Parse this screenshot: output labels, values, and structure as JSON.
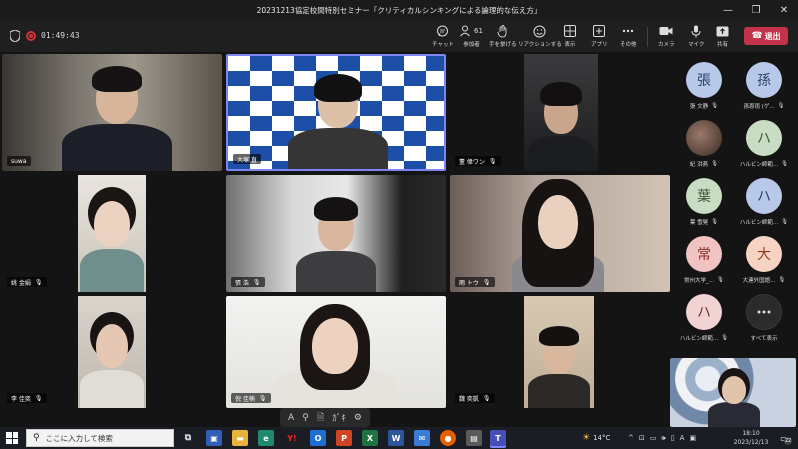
{
  "window": {
    "title": "20231213協定校間特別セミナー「クリティカルシンキングによる論理的な伝え方」",
    "controls": [
      "—",
      "❐",
      "✕"
    ]
  },
  "meeting": {
    "timer": "01:49:43",
    "participants_count": "61",
    "toolbar": [
      {
        "id": "chat",
        "icon": "chat-icon",
        "label": "チャット"
      },
      {
        "id": "people",
        "icon": "people-icon",
        "label": "参加者"
      },
      {
        "id": "raise",
        "icon": "hand-icon",
        "label": "手を挙げる"
      },
      {
        "id": "react",
        "icon": "smile-icon",
        "label": "リアクションする"
      },
      {
        "id": "view",
        "icon": "grid-icon",
        "label": "表示"
      },
      {
        "id": "apps",
        "icon": "plus-square-icon",
        "label": "アプリ"
      },
      {
        "id": "more",
        "icon": "ellipsis-icon",
        "label": "その他"
      },
      {
        "id": "camera",
        "icon": "camera-icon",
        "label": "カメラ"
      },
      {
        "id": "mic",
        "icon": "mic-icon",
        "label": "マイク"
      },
      {
        "id": "share",
        "icon": "share-icon",
        "label": "共有"
      }
    ],
    "leave_label": "退出"
  },
  "tiles": [
    {
      "name": "suwa",
      "mic": ""
    },
    {
      "name": "大塚 直",
      "mic": ""
    },
    {
      "name": "董 偉ワン",
      "mic": "🎙"
    },
    {
      "name": "姚 金娟",
      "mic": "🎙"
    },
    {
      "name": "張 浩",
      "mic": "🎙"
    },
    {
      "name": "雨 トウ",
      "mic": "🎙"
    },
    {
      "name": "李 佳奕",
      "mic": "🎙"
    },
    {
      "name": "倪 佳楠",
      "mic": "🎙"
    },
    {
      "name": "魏 奕凱",
      "mic": "🎙"
    }
  ],
  "side_avatars": [
    {
      "initial": "張",
      "name": "張 文静",
      "color": "#b8c8e8",
      "text_color": "#2b3f6b"
    },
    {
      "initial": "孫",
      "name": "孫恩雨 (ゲ...",
      "color": "#b8c8e8",
      "text_color": "#2b3f6b"
    },
    {
      "initial": "",
      "name": "紀 洪燕",
      "color": "#6a4a3a",
      "text_color": "#ffffff"
    },
    {
      "initial": "ハ",
      "name": "ハルビン師範...",
      "color": "#c9dcc4",
      "text_color": "#3b5a33"
    },
    {
      "initial": "葉",
      "name": "葉 雪晃",
      "color": "#c9dcc4",
      "text_color": "#3b5a33"
    },
    {
      "initial": "ハ",
      "name": "ハルビン師範...",
      "color": "#b8c8e8",
      "text_color": "#2b3f6b"
    },
    {
      "initial": "常",
      "name": "常州大学_...",
      "color": "#f2c3c3",
      "text_color": "#8b2c2c"
    },
    {
      "initial": "大",
      "name": "大連外国語...",
      "color": "#f7d3c3",
      "text_color": "#8b3c1c"
    },
    {
      "initial": "ハ",
      "name": "ハルビン師範...",
      "color": "#f2d3d3",
      "text_color": "#7a2c3c"
    }
  ],
  "show_all": {
    "label": "すべて表示",
    "icon": "ellipsis-icon"
  },
  "mic_symbol": "🎙",
  "reaction_bar": [
    "A",
    "⚲",
    "🗎",
    "ｶﾞｷ",
    "⚙"
  ],
  "taskbar": {
    "search_placeholder": "ここに入力して検索",
    "weather": "14°C",
    "ime": "A",
    "time": "18:10",
    "date": "2023/12/13",
    "notification_count": "22"
  }
}
